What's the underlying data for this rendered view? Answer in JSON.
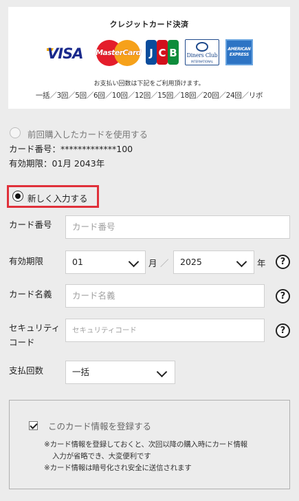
{
  "payment_box": {
    "title": "クレジットカード決済",
    "brands": [
      "VISA",
      "MasterCard",
      "JCB",
      "Diners Club International",
      "American Express"
    ],
    "logo_text": {
      "visa": "VISA",
      "mastercard": "MasterCard",
      "jcb": [
        "J",
        "C",
        "B"
      ],
      "diners_line1": "Diners Club",
      "diners_line2": "INTERNATIONAL",
      "amex": "AMERICAN EXPRESS"
    },
    "installments_note": "お支払い回数は下記をご利用頂けます。",
    "installments": "一括／3回／5回／6回／10回／12回／15回／18回／20回／24回／リボ"
  },
  "previous_card": {
    "option_label": "前回購入したカードを使用する",
    "card_number": "カード番号：*************100",
    "expiry": "有効期限：01月 2043年",
    "selected": false
  },
  "new_card": {
    "option_label": "新しく入力する",
    "selected": true
  },
  "form": {
    "card_number": {
      "label": "カード番号",
      "placeholder": "カード番号"
    },
    "expiry": {
      "label": "有効期限",
      "month_value": "01",
      "month_unit": "月",
      "separator": "／",
      "year_value": "2025",
      "year_unit": "年"
    },
    "card_name": {
      "label": "カード名義",
      "placeholder": "カード名義"
    },
    "security_code": {
      "label_line1": "セキュリティ",
      "label_line2": "コード",
      "placeholder": "セキュリティコード"
    },
    "installments": {
      "label": "支払回数",
      "value": "一括"
    },
    "help_symbol": "?"
  },
  "register": {
    "checked": true,
    "label": "このカード情報を登録する",
    "note_line1": "※カード情報を登録しておくと、次回以降の購入時にカード情報",
    "note_line2": "入力が省略でき、大変便利です",
    "note_line3": "※カード情報は暗号化され安全に送信されます"
  },
  "colors": {
    "highlight_border": "#e0303a",
    "background": "#ececec"
  }
}
